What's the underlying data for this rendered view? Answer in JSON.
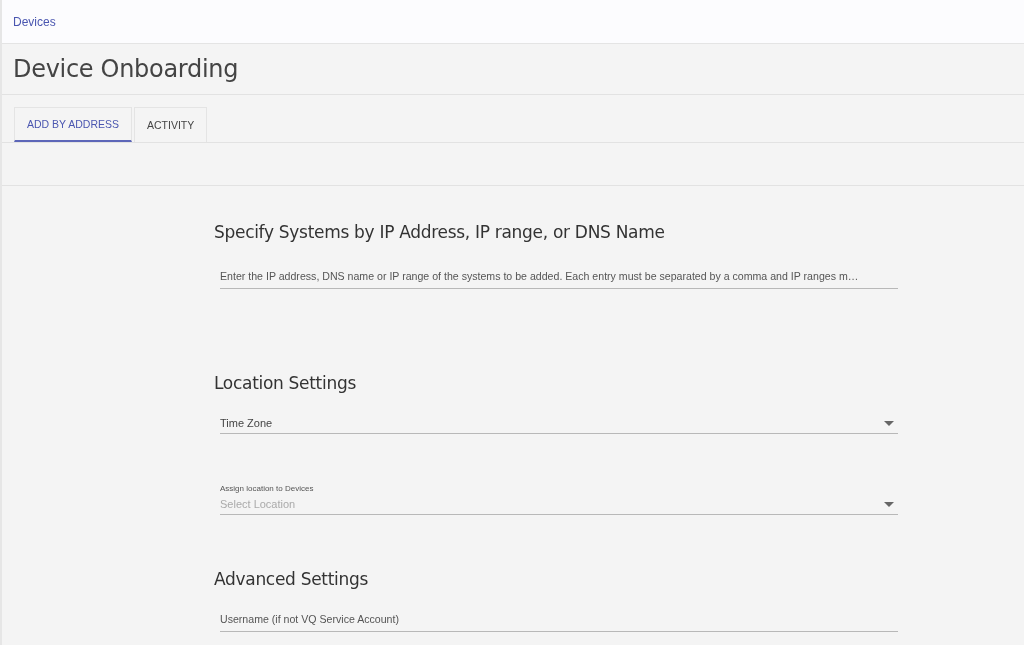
{
  "breadcrumb": "Devices",
  "title": "Device Onboarding",
  "tabs": [
    {
      "label": "ADD BY ADDRESS",
      "selected": true
    },
    {
      "label": "ACTIVITY",
      "selected": false
    }
  ],
  "sections": [
    {
      "heading": "Specify Systems by IP Address, IP range, or DNS Name",
      "fields": [
        {
          "kind": "text",
          "placeholder": "Enter the IP address, DNS name or IP range of the systems to be added. Each entry must be separated by a comma and IP ranges m…"
        }
      ]
    },
    {
      "heading": "Location Settings",
      "fields": [
        {
          "kind": "select",
          "placeholder": "Time Zone"
        },
        {
          "kind": "select",
          "label": "Assign location to Devices",
          "placeholder": "Select Location"
        }
      ]
    },
    {
      "heading": "Advanced Settings",
      "fields": [
        {
          "kind": "text",
          "placeholder": "Username (if not VQ Service Account)"
        }
      ]
    }
  ]
}
